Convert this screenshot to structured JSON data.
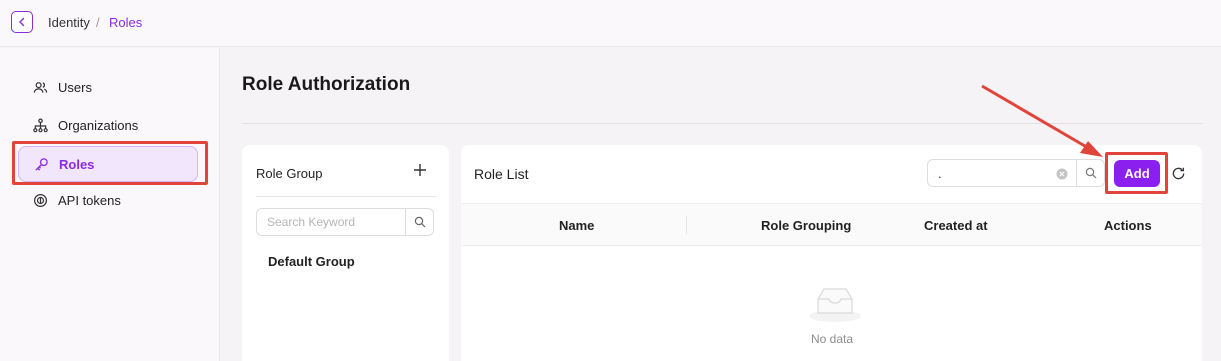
{
  "breadcrumb": {
    "parent": "Identity",
    "separator": "/",
    "current": "Roles"
  },
  "sidebar": {
    "items": [
      {
        "label": "Users",
        "icon": "users-icon",
        "active": false
      },
      {
        "label": "Organizations",
        "icon": "org-tree-icon",
        "active": false
      },
      {
        "label": "Roles",
        "icon": "key-icon",
        "active": true
      },
      {
        "label": "API tokens",
        "icon": "token-icon",
        "active": false
      }
    ]
  },
  "page": {
    "title": "Role Authorization"
  },
  "role_group": {
    "title": "Role Group",
    "search_placeholder": "Search Keyword",
    "items": [
      "Default Group"
    ]
  },
  "role_list": {
    "title": "Role List",
    "search_value": ".",
    "add_label": "Add",
    "columns": [
      "Name",
      "Role Grouping",
      "Created at",
      "Actions"
    ],
    "empty_text": "No data"
  },
  "colors": {
    "accent": "#8b2be2",
    "add_button": "#8b1ff0",
    "highlight": "#e0443a"
  }
}
